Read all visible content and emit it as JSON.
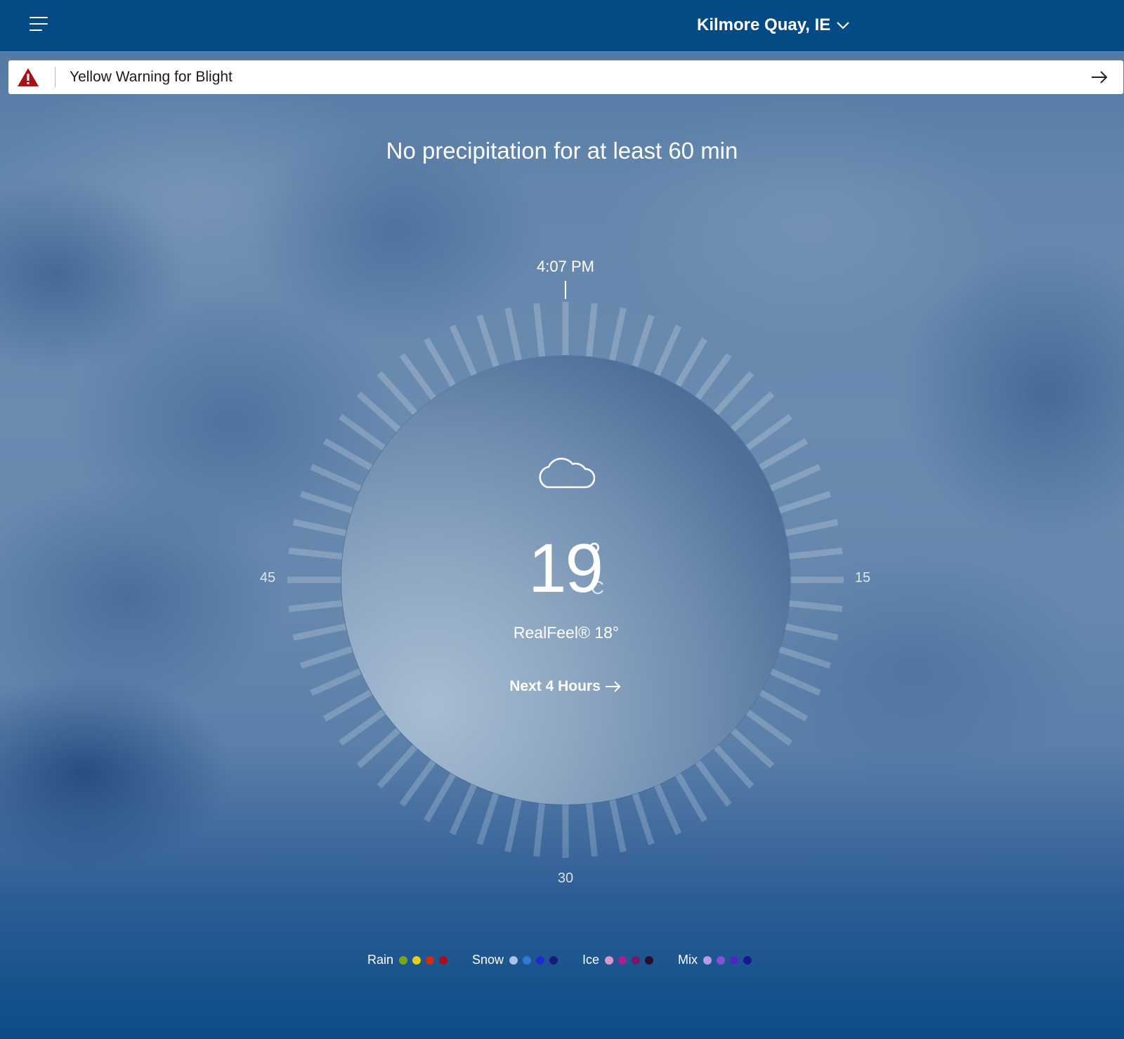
{
  "header": {
    "location": "Kilmore Quay, IE",
    "menu_icon": "hamburger-menu-icon",
    "dropdown_icon": "chevron-down-icon"
  },
  "alert": {
    "text": "Yellow Warning for Blight",
    "icon": "warning-triangle-icon",
    "icon_color": "#a3141b",
    "arrow_icon": "arrow-right-icon"
  },
  "minutecast": {
    "summary": "No precipitation for at least 60 min",
    "current_time": "4:07 PM",
    "minute_labels": {
      "right": "15",
      "bottom": "30",
      "left": "45"
    }
  },
  "current": {
    "condition_icon": "cloud-icon",
    "temperature": "19",
    "degree": "°",
    "unit": "C",
    "realfeel": "RealFeel® 18°",
    "next_link": "Next 4 Hours"
  },
  "legend": [
    {
      "label": "Rain",
      "colors": [
        "#7aa516",
        "#e0cf12",
        "#cf2e14",
        "#a4101a"
      ]
    },
    {
      "label": "Snow",
      "colors": [
        "#a8c2ec",
        "#2f7ad6",
        "#1c2bd6",
        "#131c7a"
      ]
    },
    {
      "label": "Ice",
      "colors": [
        "#d99ac9",
        "#a8208e",
        "#7a1764",
        "#2a0e2e"
      ]
    },
    {
      "label": "Mix",
      "colors": [
        "#b69be8",
        "#7f52d8",
        "#4f24c2",
        "#1a1698"
      ]
    }
  ]
}
